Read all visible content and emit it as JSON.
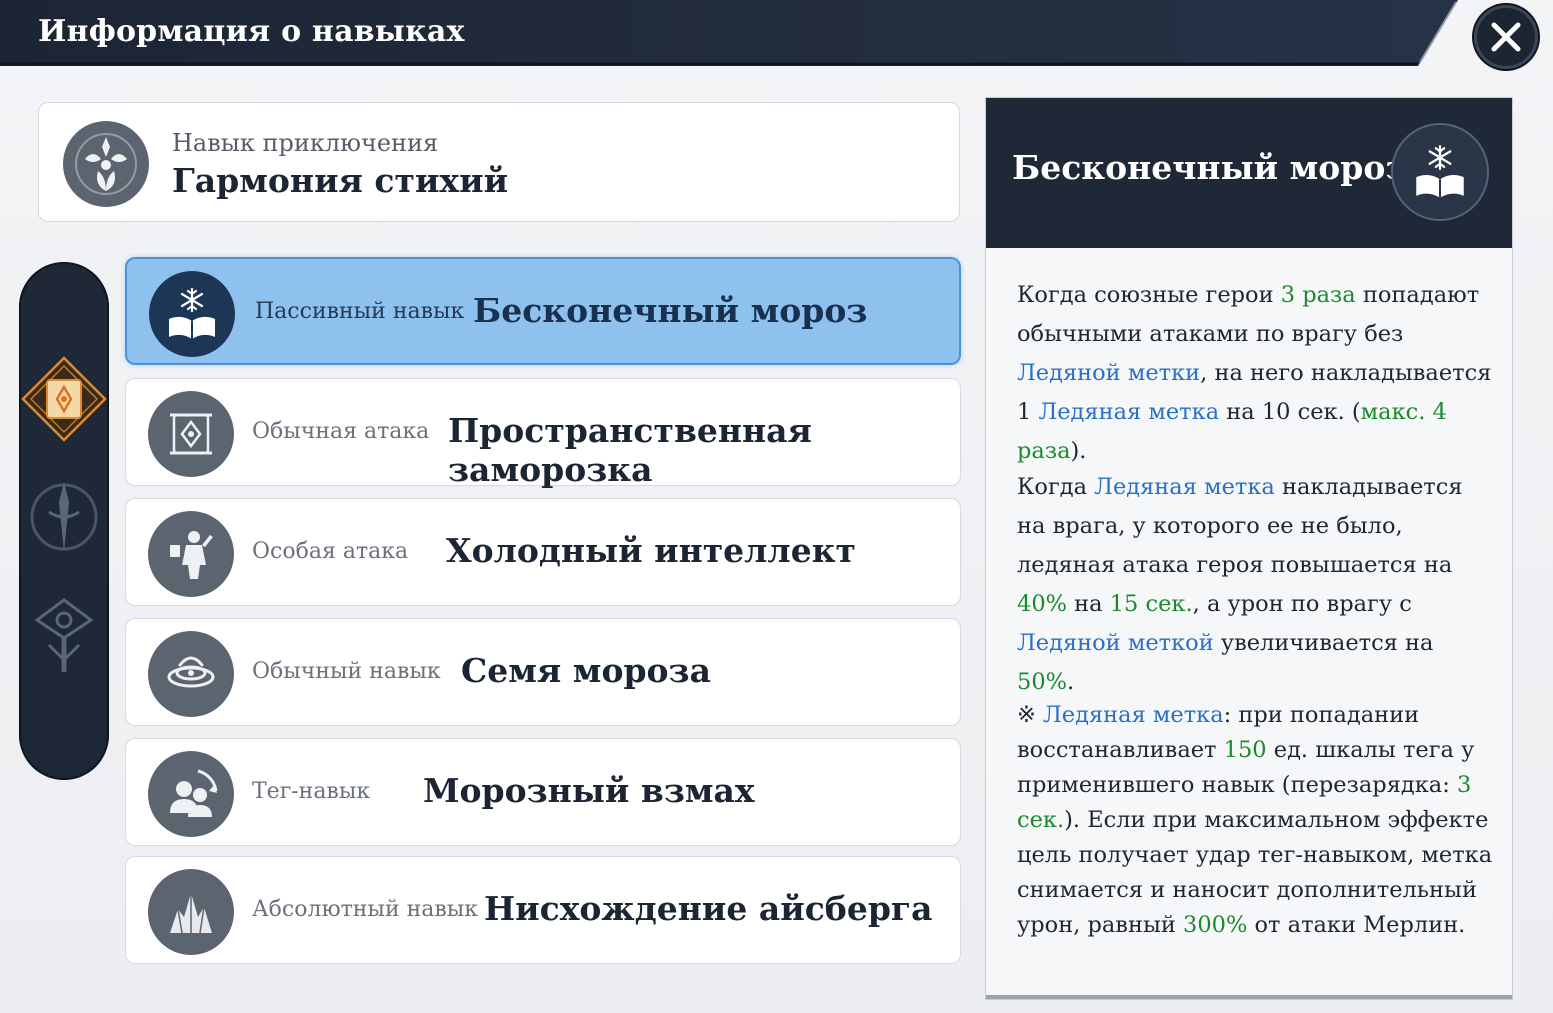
{
  "window": {
    "title": "Информация о навыках",
    "close_icon": "close-x-icon"
  },
  "adventure": {
    "subtitle": "Навык приключения",
    "name": "Гармония стихий",
    "icon": "elements-harmony-icon"
  },
  "side_tabs": [
    {
      "icon": "scroll-rune-icon",
      "active": true
    },
    {
      "icon": "spear-emblem-icon",
      "active": false
    },
    {
      "icon": "shield-emblem-icon",
      "active": false
    }
  ],
  "skills": [
    {
      "type": "Пассивный навык",
      "name": "Бесконечный мороз",
      "icon": "frost-book-icon",
      "active": true
    },
    {
      "type": "Обычная атака",
      "name": "Пространственная заморозка",
      "icon": "rune-scroll-icon",
      "active": false
    },
    {
      "type": "Особая атака",
      "name": "Холодный интеллект",
      "icon": "mage-figure-icon",
      "active": false
    },
    {
      "type": "Обычный навык",
      "name": "Семя мороза",
      "icon": "frost-swirl-icon",
      "active": false
    },
    {
      "type": "Тег-навык",
      "name": "Морозный взмах",
      "icon": "tag-swap-icon",
      "active": false
    },
    {
      "type": "Абсолютный навык",
      "name": "Нисхождение айсберга",
      "icon": "iceberg-icon",
      "active": false
    }
  ],
  "detail": {
    "title": "Бесконечный мороз",
    "icon": "frost-book-icon",
    "p1": {
      "t1": "Когда союзные герои ",
      "g1": "3 раза",
      "t2": " попадают обычными атаками по врагу без ",
      "b1": "Ледяной метки",
      "t3": ", на него накладывается 1 ",
      "b2": "Ледяная метка",
      "t4": " на 10 сек. (",
      "g2": "макс. 4 раза",
      "t5": ")."
    },
    "p2": {
      "t1": "Когда ",
      "b1": "Ледяная метка",
      "t2": " накладывается на врага, у которого ее не было, ледяная атака героя повышается на ",
      "g1": "40%",
      "t3": " на ",
      "g2": "15 сек.",
      "t4": ", а урон по врагу с ",
      "b2": "Ледяной меткой",
      "t5": " увеличивается на ",
      "g3": "50%",
      "t6": "."
    },
    "p3": {
      "t0": "※ ",
      "b1": "Ледяная метка",
      "t1": ": при попадании восстанавливает ",
      "g1": "150",
      "t2": " ед. шкалы тега у применившего навык (перезарядка: ",
      "g2": "3 сек.",
      "t3": "). Если при максимальном эффекте цель получает удар тег-навыком, метка снимается и наносит дополнительный урон, равный ",
      "g3": "300%",
      "t4": " от атаки Мерлин."
    }
  }
}
